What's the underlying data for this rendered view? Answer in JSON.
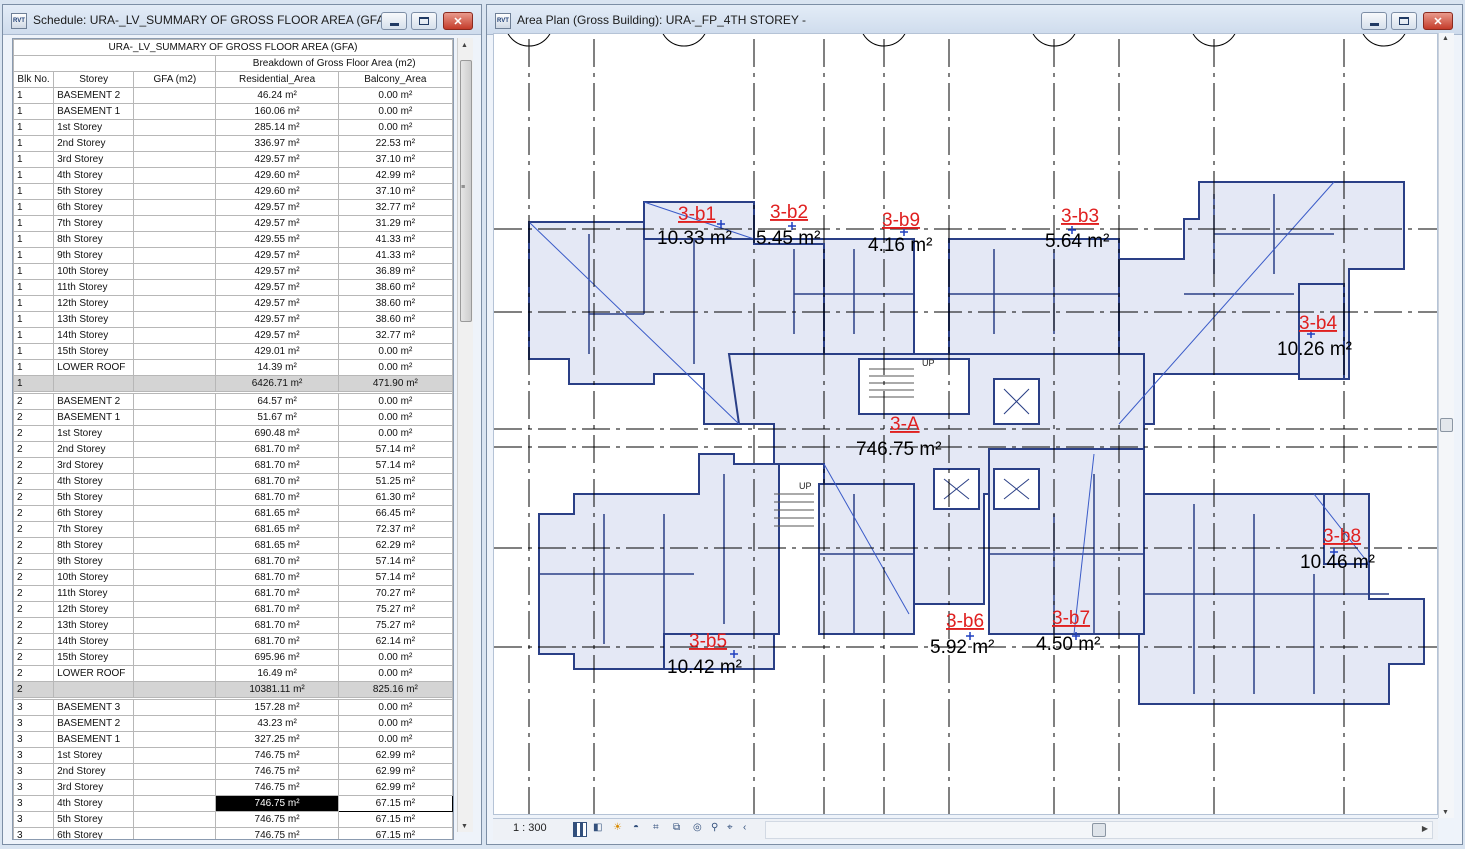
{
  "schedule_window": {
    "title": "Schedule: URA-_LV_SUMMARY OF GROSS FLOOR AREA (GFA) -",
    "app_icon": "RVT",
    "table_title": "URA-_LV_SUMMARY OF GROSS FLOOR AREA (GFA)",
    "group_header": "Breakdown of Gross Floor Area (m2)",
    "headers": [
      "Blk No.",
      "Storey",
      "GFA (m2)",
      "Residential_Area",
      "Balcony_Area"
    ],
    "rows": [
      {
        "blk": "1",
        "storey": "BASEMENT 2",
        "gfa": "",
        "res": "46.24 m²",
        "bal": "0.00 m²"
      },
      {
        "blk": "1",
        "storey": "BASEMENT 1",
        "gfa": "",
        "res": "160.06 m²",
        "bal": "0.00 m²"
      },
      {
        "blk": "1",
        "storey": "1st Storey",
        "gfa": "",
        "res": "285.14 m²",
        "bal": "0.00 m²"
      },
      {
        "blk": "1",
        "storey": "2nd Storey",
        "gfa": "",
        "res": "336.97 m²",
        "bal": "22.53 m²"
      },
      {
        "blk": "1",
        "storey": "3rd Storey",
        "gfa": "",
        "res": "429.57 m²",
        "bal": "37.10 m²"
      },
      {
        "blk": "1",
        "storey": "4th Storey",
        "gfa": "",
        "res": "429.60 m²",
        "bal": "42.99 m²"
      },
      {
        "blk": "1",
        "storey": "5th Storey",
        "gfa": "",
        "res": "429.60 m²",
        "bal": "37.10 m²"
      },
      {
        "blk": "1",
        "storey": "6th Storey",
        "gfa": "",
        "res": "429.57 m²",
        "bal": "32.77 m²"
      },
      {
        "blk": "1",
        "storey": "7th Storey",
        "gfa": "",
        "res": "429.57 m²",
        "bal": "31.29 m²"
      },
      {
        "blk": "1",
        "storey": "8th Storey",
        "gfa": "",
        "res": "429.55 m²",
        "bal": "41.33 m²"
      },
      {
        "blk": "1",
        "storey": "9th Storey",
        "gfa": "",
        "res": "429.57 m²",
        "bal": "41.33 m²"
      },
      {
        "blk": "1",
        "storey": "10th Storey",
        "gfa": "",
        "res": "429.57 m²",
        "bal": "36.89 m²"
      },
      {
        "blk": "1",
        "storey": "11th Storey",
        "gfa": "",
        "res": "429.57 m²",
        "bal": "38.60 m²"
      },
      {
        "blk": "1",
        "storey": "12th Storey",
        "gfa": "",
        "res": "429.57 m²",
        "bal": "38.60 m²"
      },
      {
        "blk": "1",
        "storey": "13th Storey",
        "gfa": "",
        "res": "429.57 m²",
        "bal": "38.60 m²"
      },
      {
        "blk": "1",
        "storey": "14th Storey",
        "gfa": "",
        "res": "429.57 m²",
        "bal": "32.77 m²"
      },
      {
        "blk": "1",
        "storey": "15th Storey",
        "gfa": "",
        "res": "429.01 m²",
        "bal": "0.00 m²"
      },
      {
        "blk": "1",
        "storey": "LOWER ROOF",
        "gfa": "",
        "res": "14.39 m²",
        "bal": "0.00 m²"
      },
      {
        "type": "total",
        "blk": "1",
        "storey": "",
        "gfa": "",
        "res": "6426.71 m²",
        "bal": "471.90 m²"
      },
      {
        "type": "sep"
      },
      {
        "blk": "2",
        "storey": "BASEMENT 2",
        "gfa": "",
        "res": "64.57 m²",
        "bal": "0.00 m²"
      },
      {
        "blk": "2",
        "storey": "BASEMENT 1",
        "gfa": "",
        "res": "51.67 m²",
        "bal": "0.00 m²"
      },
      {
        "blk": "2",
        "storey": "1st Storey",
        "gfa": "",
        "res": "690.48 m²",
        "bal": "0.00 m²"
      },
      {
        "blk": "2",
        "storey": "2nd Storey",
        "gfa": "",
        "res": "681.70 m²",
        "bal": "57.14 m²"
      },
      {
        "blk": "2",
        "storey": "3rd Storey",
        "gfa": "",
        "res": "681.70 m²",
        "bal": "57.14 m²"
      },
      {
        "blk": "2",
        "storey": "4th Storey",
        "gfa": "",
        "res": "681.70 m²",
        "bal": "51.25 m²"
      },
      {
        "blk": "2",
        "storey": "5th Storey",
        "gfa": "",
        "res": "681.70 m²",
        "bal": "61.30 m²"
      },
      {
        "blk": "2",
        "storey": "6th Storey",
        "gfa": "",
        "res": "681.65 m²",
        "bal": "66.45 m²"
      },
      {
        "blk": "2",
        "storey": "7th Storey",
        "gfa": "",
        "res": "681.65 m²",
        "bal": "72.37 m²"
      },
      {
        "blk": "2",
        "storey": "8th Storey",
        "gfa": "",
        "res": "681.65 m²",
        "bal": "62.29 m²"
      },
      {
        "blk": "2",
        "storey": "9th Storey",
        "gfa": "",
        "res": "681.70 m²",
        "bal": "57.14 m²"
      },
      {
        "blk": "2",
        "storey": "10th Storey",
        "gfa": "",
        "res": "681.70 m²",
        "bal": "57.14 m²"
      },
      {
        "blk": "2",
        "storey": "11th Storey",
        "gfa": "",
        "res": "681.70 m²",
        "bal": "70.27 m²"
      },
      {
        "blk": "2",
        "storey": "12th Storey",
        "gfa": "",
        "res": "681.70 m²",
        "bal": "75.27 m²"
      },
      {
        "blk": "2",
        "storey": "13th Storey",
        "gfa": "",
        "res": "681.70 m²",
        "bal": "75.27 m²"
      },
      {
        "blk": "2",
        "storey": "14th Storey",
        "gfa": "",
        "res": "681.70 m²",
        "bal": "62.14 m²"
      },
      {
        "blk": "2",
        "storey": "15th Storey",
        "gfa": "",
        "res": "695.96 m²",
        "bal": "0.00 m²"
      },
      {
        "blk": "2",
        "storey": "LOWER ROOF",
        "gfa": "",
        "res": "16.49 m²",
        "bal": "0.00 m²"
      },
      {
        "type": "total",
        "blk": "2",
        "storey": "",
        "gfa": "",
        "res": "10381.11 m²",
        "bal": "825.16 m²"
      },
      {
        "type": "sep"
      },
      {
        "blk": "3",
        "storey": "BASEMENT 3",
        "gfa": "",
        "res": "157.28 m²",
        "bal": "0.00 m²"
      },
      {
        "blk": "3",
        "storey": "BASEMENT 2",
        "gfa": "",
        "res": "43.23 m²",
        "bal": "0.00 m²"
      },
      {
        "blk": "3",
        "storey": "BASEMENT 1",
        "gfa": "",
        "res": "327.25 m²",
        "bal": "0.00 m²"
      },
      {
        "blk": "3",
        "storey": "1st Storey",
        "gfa": "",
        "res": "746.75 m²",
        "bal": "62.99 m²"
      },
      {
        "blk": "3",
        "storey": "2nd Storey",
        "gfa": "",
        "res": "746.75 m²",
        "bal": "62.99 m²"
      },
      {
        "blk": "3",
        "storey": "3rd Storey",
        "gfa": "",
        "res": "746.75 m²",
        "bal": "62.99 m²"
      },
      {
        "blk": "3",
        "storey": "4th Storey",
        "gfa": "",
        "res": "746.75 m²",
        "bal": "67.15 m²",
        "selected": true
      },
      {
        "blk": "3",
        "storey": "5th Storey",
        "gfa": "",
        "res": "746.75 m²",
        "bal": "67.15 m²"
      },
      {
        "blk": "3",
        "storey": "6th Storey",
        "gfa": "",
        "res": "746.75 m²",
        "bal": "67.15 m²"
      }
    ]
  },
  "plan_window": {
    "title": "Area Plan (Gross Building): URA-_FP_4TH STOREY -",
    "app_icon": "RVT",
    "scale": "1 : 300",
    "area_tags": [
      {
        "name": "3-b1",
        "area": "10.33 m²"
      },
      {
        "name": "3-b2",
        "area": "5.45 m²"
      },
      {
        "name": "3-b9",
        "area": "4.16 m²"
      },
      {
        "name": "3-b3",
        "area": "5.64 m²"
      },
      {
        "name": "3-b4",
        "area": "10.26 m²"
      },
      {
        "name": "3-A",
        "area": "746.75 m²"
      },
      {
        "name": "3-b8",
        "area": "10.46 m²"
      },
      {
        "name": "3-b5",
        "area": "10.42 m²"
      },
      {
        "name": "3-b6",
        "area": "5.92 m²"
      },
      {
        "name": "3-b7",
        "area": "4.50 m²"
      }
    ],
    "stair_labels": [
      "UP",
      "UP"
    ],
    "view_control_icons": [
      "detail-level-icon",
      "visual-style-icon",
      "sun-path-icon",
      "shadows-icon",
      "crop-view-icon",
      "show-crop-icon",
      "temporary-hide-icon",
      "reveal-hidden-icon",
      "analytical-model-icon",
      "highlight-displacement-icon"
    ]
  },
  "colors": {
    "area_fill": "#e4e8f5",
    "wall": "#2a3f86",
    "tag_name": "#e02020",
    "tag_area": "#000000",
    "grid_line": "#000000"
  }
}
